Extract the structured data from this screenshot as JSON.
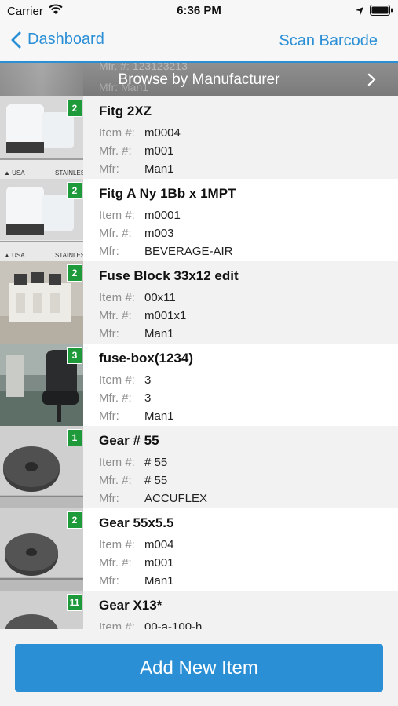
{
  "status": {
    "carrier": "Carrier",
    "time": "6:36 PM"
  },
  "nav": {
    "back_label": "Dashboard",
    "right_label": "Scan Barcode"
  },
  "browse": {
    "label": "Browse by Manufacturer",
    "ghost_line1": "Mfr. #: 123123213",
    "ghost_line2": "Mfr: Man1"
  },
  "labels": {
    "item": "Item #:",
    "mfr_no": "Mfr. #:",
    "mfr": "Mfr:"
  },
  "items": [
    {
      "title": "Fitg 2XZ",
      "count": "2",
      "item_no": "m0004",
      "mfr_no": "m001",
      "mfr": "Man1",
      "photo": "white-fitting"
    },
    {
      "title": "Fitg A Ny 1Bb x 1MPT",
      "count": "2",
      "item_no": "m0001",
      "mfr_no": "m003",
      "mfr": "BEVERAGE-AIR",
      "photo": "white-fitting"
    },
    {
      "title": "Fuse Block 33x12 edit",
      "count": "2",
      "item_no": "00x11",
      "mfr_no": "m001x1",
      "mfr": "Man1",
      "photo": "fuse-block"
    },
    {
      "title": "fuse-box(1234)",
      "count": "3",
      "item_no": "3",
      "mfr_no": "3",
      "mfr": "Man1",
      "photo": "office-chair"
    },
    {
      "title": "Gear # 55",
      "count": "1",
      "item_no": "# 55",
      "mfr_no": "# 55",
      "mfr": "ACCUFLEX",
      "photo": "gear"
    },
    {
      "title": "Gear 55x5.5",
      "count": "2",
      "item_no": "m004",
      "mfr_no": "m001",
      "mfr": "Man1",
      "photo": "gear"
    },
    {
      "title": "Gear X13*",
      "count": "11",
      "item_no": "00-a-100-h",
      "mfr_no": "",
      "mfr": "",
      "photo": "gear"
    }
  ],
  "footer": {
    "add_label": "Add New Item"
  },
  "colors": {
    "accent": "#2b8fd6",
    "badge": "#1f9a3a"
  }
}
